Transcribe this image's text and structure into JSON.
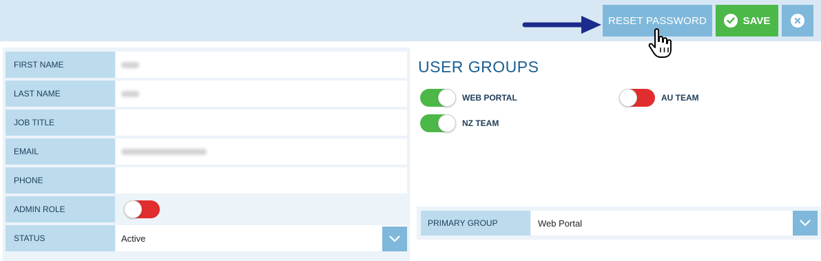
{
  "toolbar": {
    "reset_password_label": "RESET PASSWORD",
    "save_label": "SAVE"
  },
  "form": {
    "first_name": {
      "label": "FIRST NAME",
      "value": ""
    },
    "last_name": {
      "label": "LAST NAME",
      "value": ""
    },
    "job_title": {
      "label": "JOB TITLE",
      "value": ""
    },
    "email": {
      "label": "EMAIL",
      "value": ""
    },
    "phone": {
      "label": "PHONE",
      "value": ""
    },
    "admin_role": {
      "label": "ADMIN ROLE",
      "enabled": false
    },
    "status": {
      "label": "STATUS",
      "value": "Active"
    }
  },
  "user_groups": {
    "title": "USER GROUPS",
    "items": [
      {
        "label": "WEB PORTAL",
        "enabled": true
      },
      {
        "label": "AU TEAM",
        "enabled": false
      },
      {
        "label": "NZ TEAM",
        "enabled": true
      }
    ]
  },
  "primary_group": {
    "label": "PRIMARY GROUP",
    "value": "Web Portal"
  },
  "colors": {
    "accent_blue": "#7fb8da",
    "save_green": "#4cb848",
    "toggle_off_red": "#e02d2d",
    "annotation_arrow": "#1c2a8c"
  },
  "icons": [
    "check-circle-icon",
    "close-circle-icon",
    "chevron-down-icon",
    "arrow-annotation-icon",
    "hand-cursor-icon"
  ]
}
